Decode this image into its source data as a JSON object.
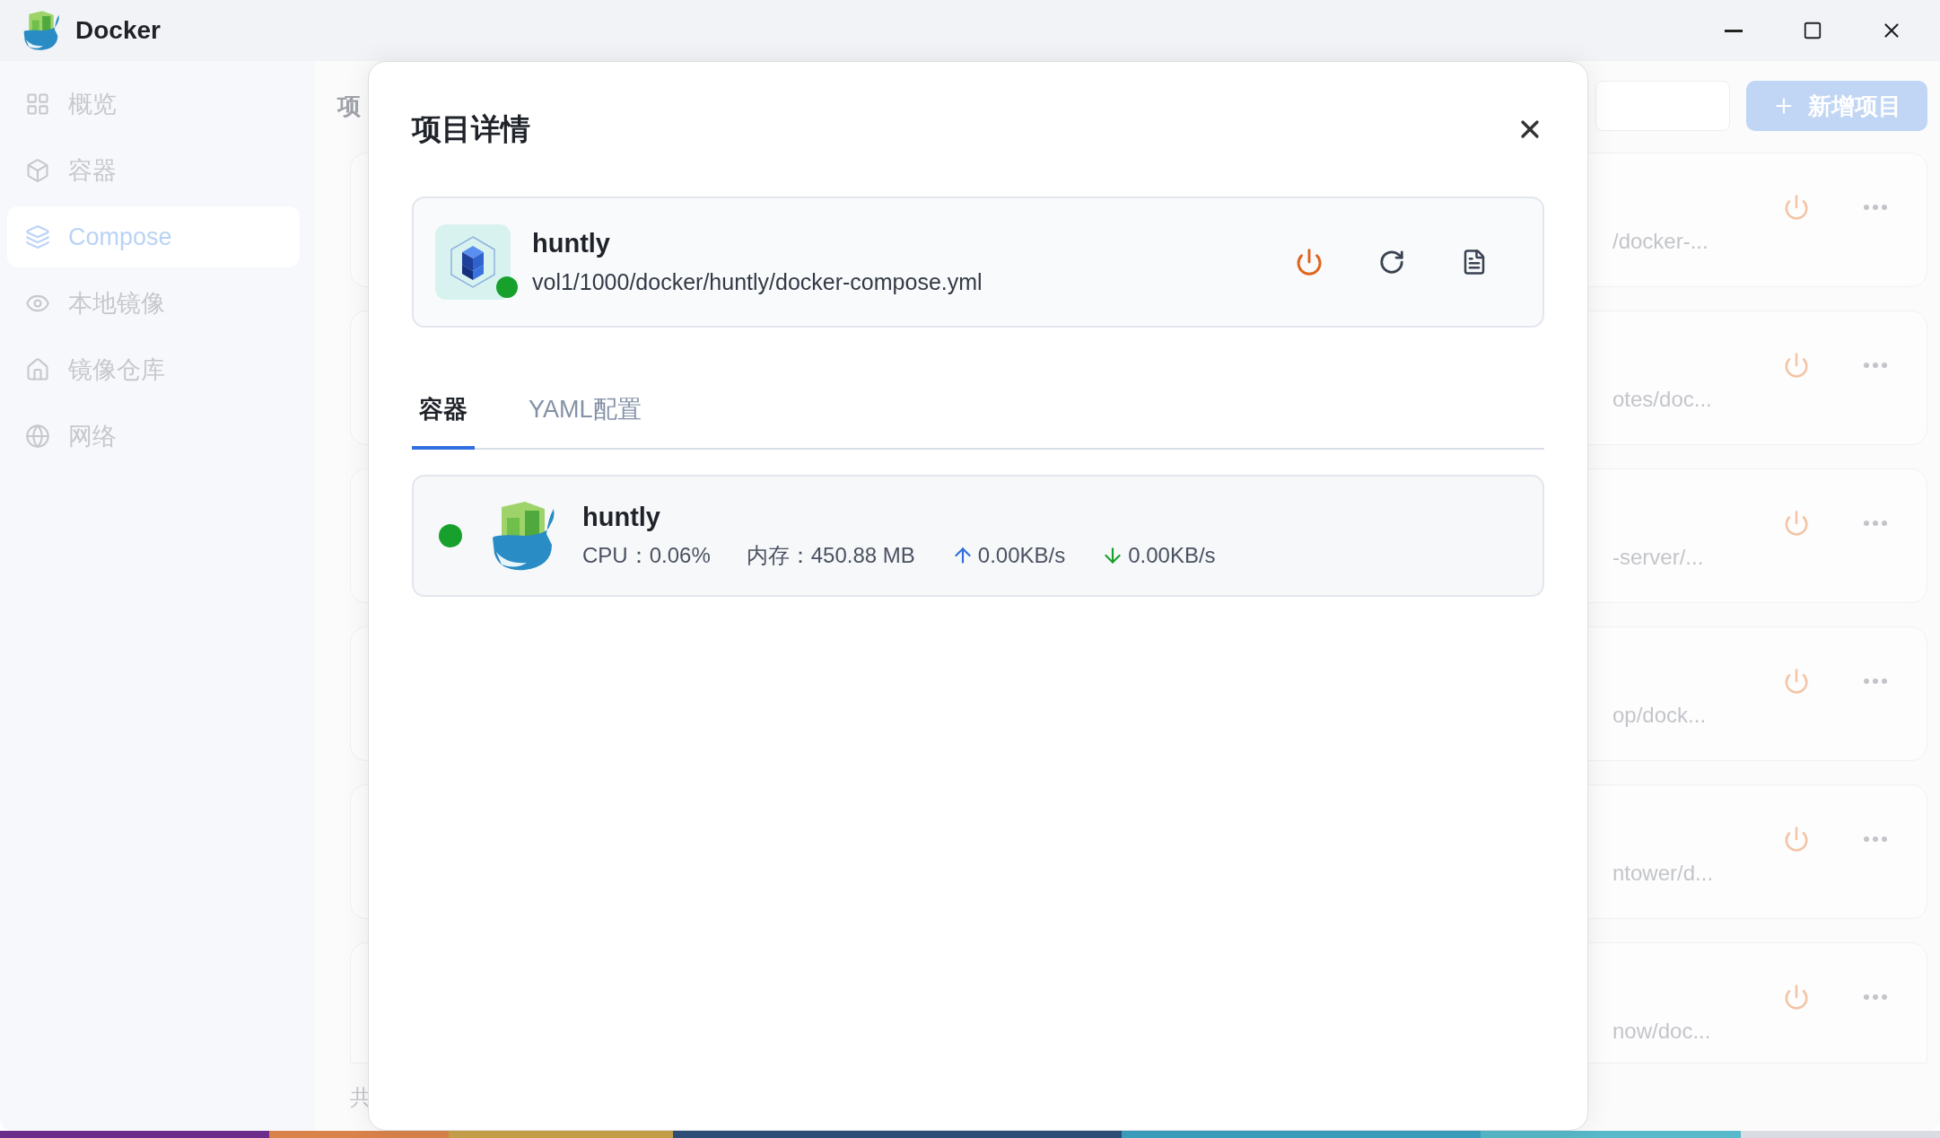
{
  "window": {
    "title": "Docker"
  },
  "sidebar": {
    "items": [
      {
        "label": "概览",
        "selected": false
      },
      {
        "label": "容器",
        "selected": false
      },
      {
        "label": "Compose",
        "selected": true
      },
      {
        "label": "本地镜像",
        "selected": false
      },
      {
        "label": "镜像仓库",
        "selected": false
      },
      {
        "label": "网络",
        "selected": false
      }
    ]
  },
  "page": {
    "title": "项",
    "add_button": "新增项目",
    "footer": "共"
  },
  "projects": [
    {
      "path": "/docker-..."
    },
    {
      "path": "otes/doc..."
    },
    {
      "path": "-server/..."
    },
    {
      "path": "op/dock..."
    },
    {
      "path": "ntower/d..."
    },
    {
      "path": "now/doc..."
    }
  ],
  "modal": {
    "title": "项目详情",
    "project": {
      "name": "huntly",
      "path": "vol1/1000/docker/huntly/docker-compose.yml",
      "running": true
    },
    "tabs": [
      {
        "label": "容器",
        "selected": true
      },
      {
        "label": "YAML配置",
        "selected": false
      }
    ],
    "containers": [
      {
        "name": "huntly",
        "running": true,
        "cpu": "CPU：0.06%",
        "memory": "内存：450.88 MB",
        "upload": "0.00KB/s",
        "download": "0.00KB/s"
      }
    ]
  }
}
